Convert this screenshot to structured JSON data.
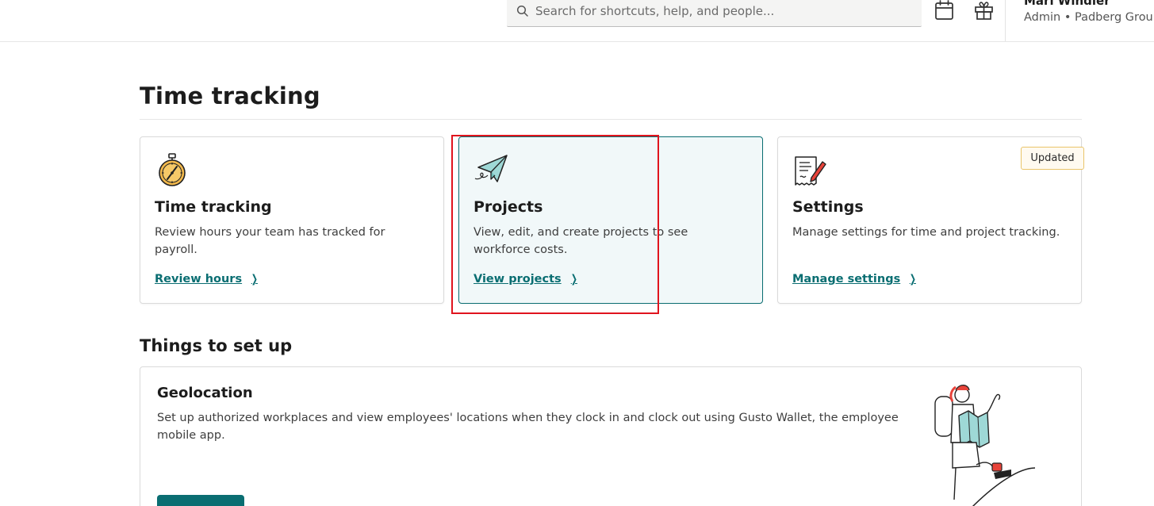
{
  "header": {
    "search_placeholder": "Search for shortcuts, help, and people...",
    "icons": [
      "search-icon",
      "calendar-icon",
      "gift-icon"
    ],
    "user": {
      "name": "Mari Windler",
      "role_company": "Admin • Padberg Group"
    }
  },
  "page": {
    "title": "Time tracking"
  },
  "cards": [
    {
      "icon": "stopwatch-icon",
      "title": "Time tracking",
      "description": "Review hours your team has tracked for payroll.",
      "link": "Review hours"
    },
    {
      "icon": "paper-plane-icon",
      "title": "Projects",
      "description": "View, edit, and create projects to see workforce costs.",
      "link": "View projects"
    },
    {
      "icon": "document-pen-icon",
      "title": "Settings",
      "description": "Manage settings for time and project tracking.",
      "link": "Manage settings",
      "badge": "Updated"
    }
  ],
  "setup": {
    "section_title": "Things to set up",
    "geolocation": {
      "title": "Geolocation",
      "description": "Set up authorized workplaces and view employees' locations when they clock in and clock out using Gusto Wallet, the employee mobile app."
    }
  },
  "colors": {
    "accent": "#0a6e72",
    "highlight": "#e0141e",
    "badge_border": "#e9c46a",
    "active_card_bg": "#f1f8f9"
  }
}
